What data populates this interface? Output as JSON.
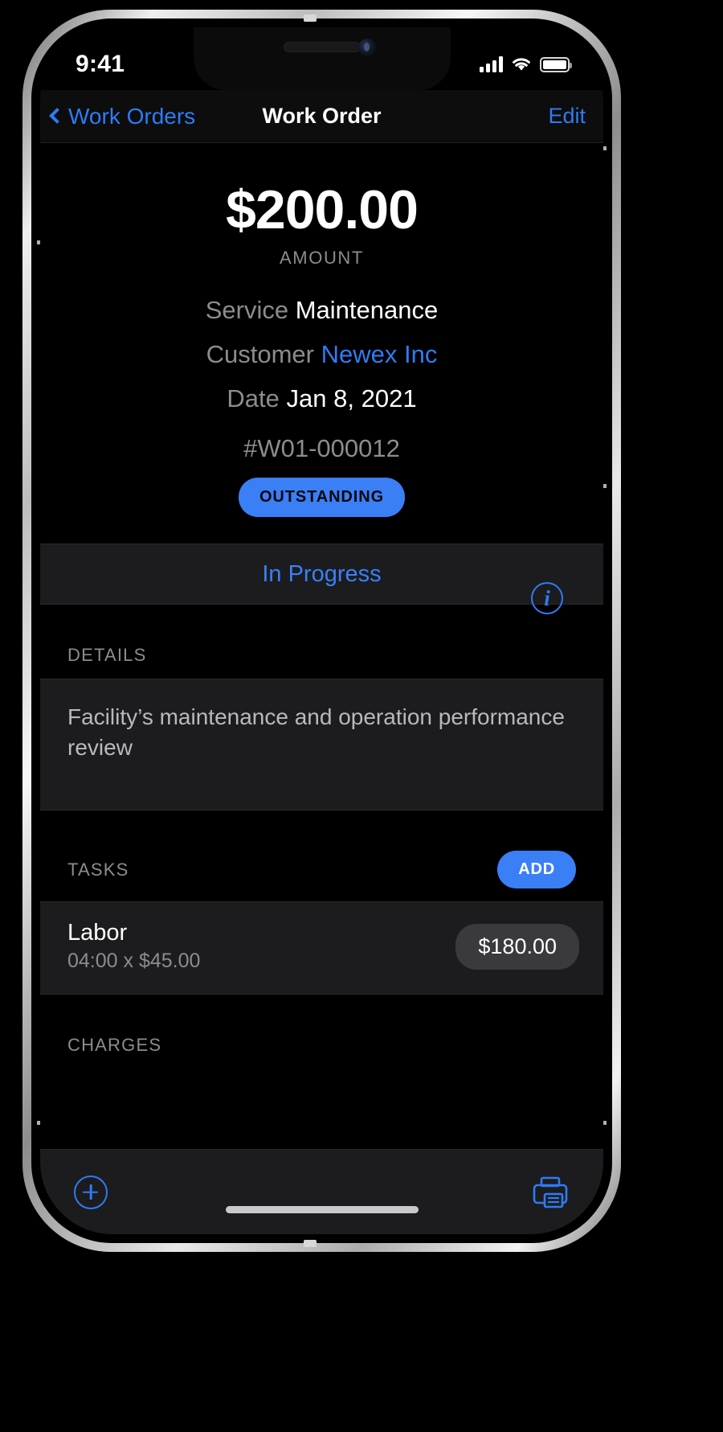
{
  "status_bar": {
    "time": "9:41",
    "cellular_icon": "signal-bars-icon",
    "wifi_icon": "wifi-icon",
    "battery_icon": "battery-full-icon"
  },
  "nav": {
    "back_label": "Work Orders",
    "back_icon": "chevron-left-icon",
    "title": "Work Order",
    "edit_label": "Edit"
  },
  "hero": {
    "amount": "$200.00",
    "amount_label": "AMOUNT",
    "rows": [
      {
        "key": "Service",
        "value": "Maintenance",
        "is_link": false
      },
      {
        "key": "Customer",
        "value": "Newex Inc",
        "is_link": true
      },
      {
        "key": "Date",
        "value": "Jan 8, 2021",
        "is_link": false
      }
    ],
    "work_order_number": "#W01-000012",
    "status_badge": "OUTSTANDING",
    "info_icon": "info-circle-icon",
    "info_glyph": "i"
  },
  "progress_action": {
    "label": "In Progress"
  },
  "details": {
    "header": "DETAILS",
    "text": "Facility’s maintenance and operation performance review"
  },
  "tasks": {
    "header": "TASKS",
    "add_label": "ADD",
    "items": [
      {
        "title": "Labor",
        "subtitle": "04:00 x $45.00",
        "price": "$180.00"
      }
    ]
  },
  "charges": {
    "header": "CHARGES"
  },
  "toolbar": {
    "add_icon": "plus-circle-icon",
    "print_icon": "printer-icon"
  },
  "colors": {
    "accent_blue": "#3b7ff7",
    "link_blue": "#2f7bf5",
    "card_bg": "#1c1c1e",
    "screen_bg": "#000000",
    "secondary_text": "#8c8c8f",
    "pill_gray": "#3a3a3c"
  }
}
